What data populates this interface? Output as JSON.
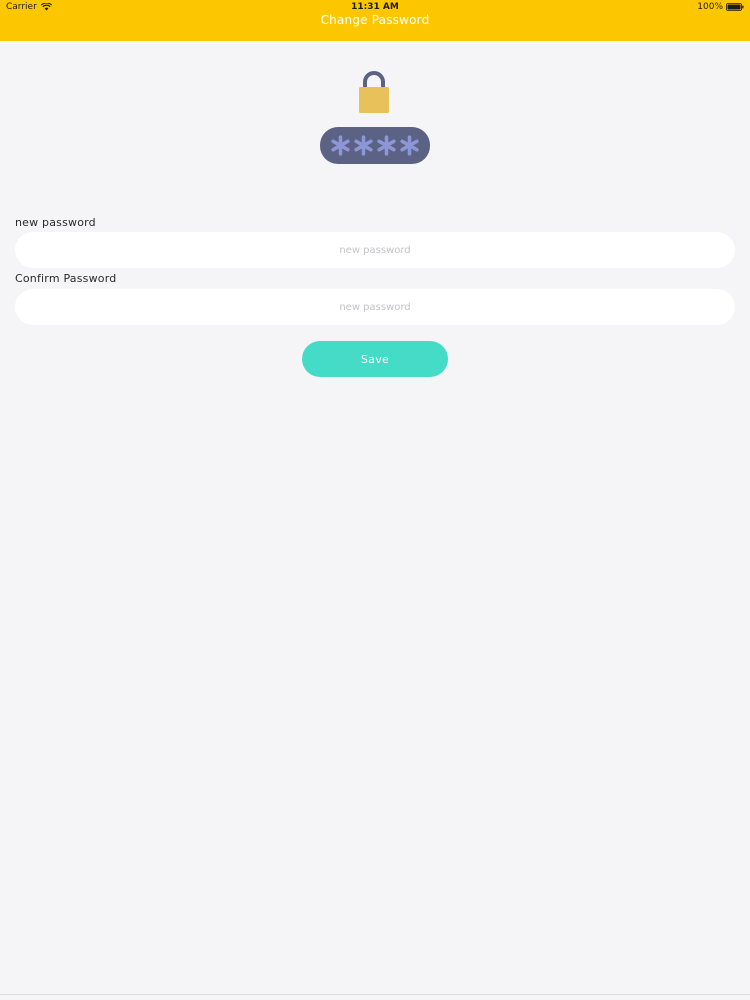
{
  "status_bar": {
    "carrier": "Carrier",
    "time": "11:31 AM",
    "battery": "100%"
  },
  "nav": {
    "title": "Change Password"
  },
  "illustration": {
    "lock_color": "#e8c15a",
    "shackle_color": "#5b6283",
    "pill_color": "#5b6283",
    "asterisk_color": "#8d96d6"
  },
  "form": {
    "new_password": {
      "label": "new password",
      "value": "",
      "placeholder": "new password"
    },
    "confirm_password": {
      "label": "Confirm Password",
      "value": "",
      "placeholder": "new password"
    },
    "save_label": "Save"
  },
  "theme": {
    "header_color": "#fdc700",
    "button_color": "#44dbc7",
    "background": "#f5f5f7"
  }
}
